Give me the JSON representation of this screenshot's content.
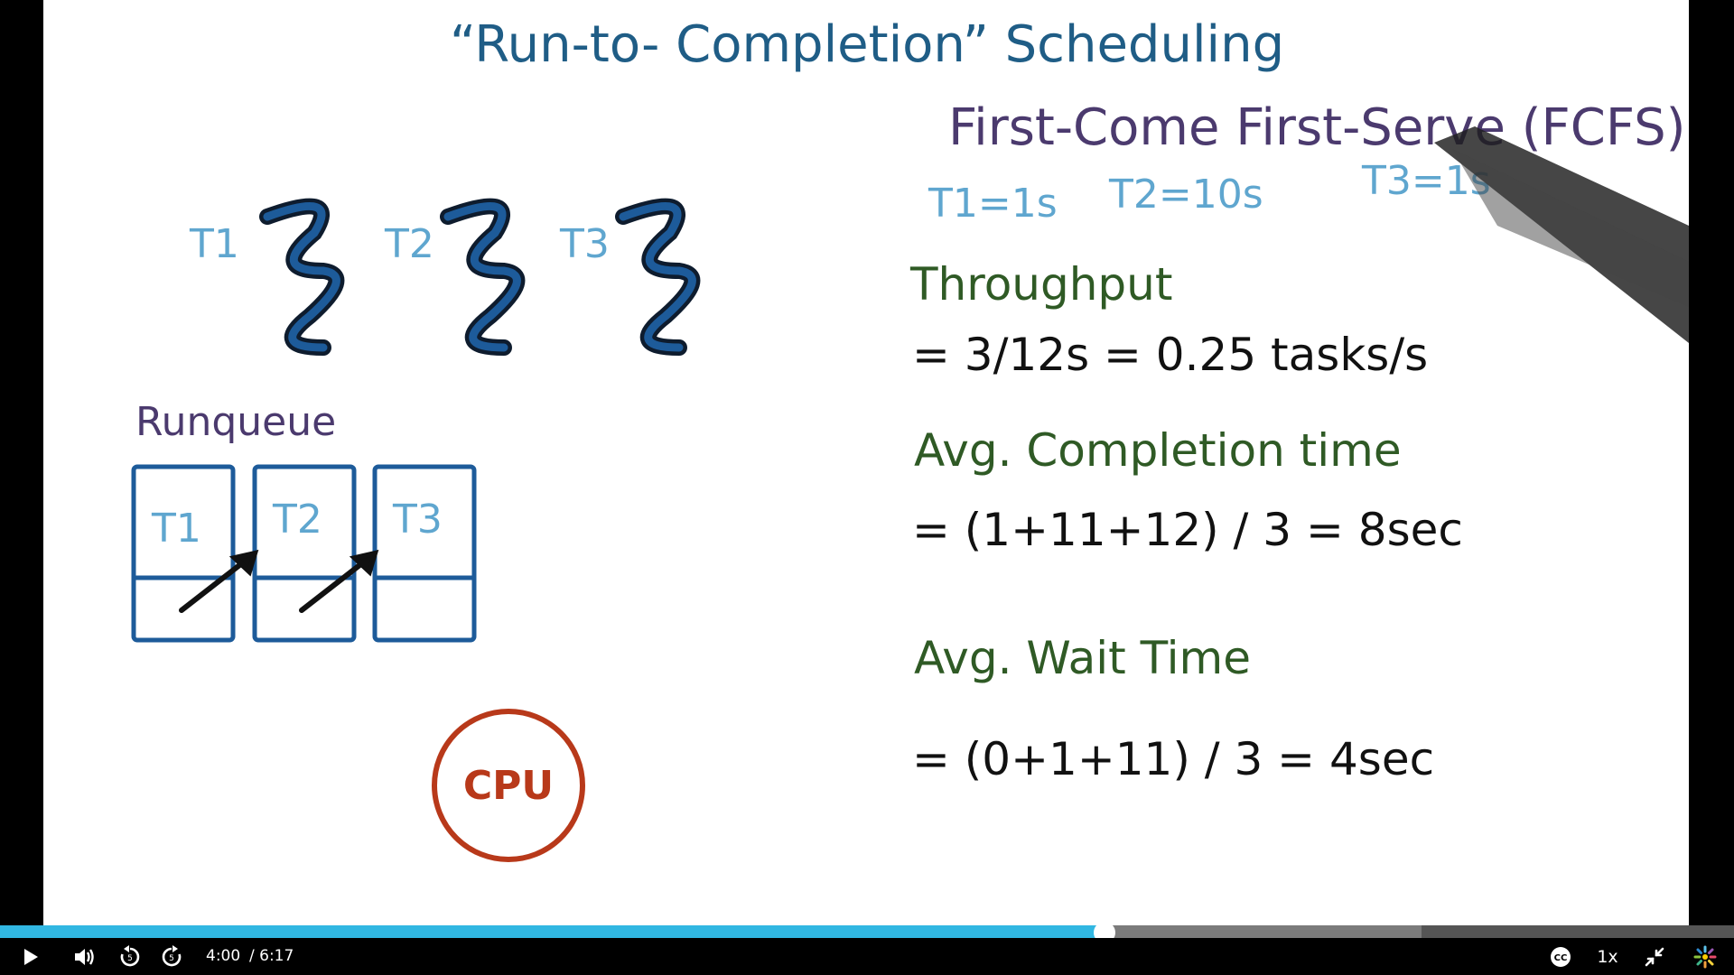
{
  "lecture": {
    "title": "“Run-to- Completion” Scheduling",
    "algorithm": "First-Come First-Serve (FCFS)",
    "task_times": [
      "T1=1s",
      "T2=10s",
      "T3=1s"
    ],
    "threads": [
      "T1",
      "T2",
      "T3"
    ],
    "runqueue_label": "Runqueue",
    "queue_items": [
      "T1",
      "T2",
      "T3"
    ],
    "cpu_label": "CPU",
    "throughput_heading": "Throughput",
    "throughput_formula": "= 3/12s = 0.25 tasks/s",
    "completion_heading": "Avg. Completion time",
    "completion_formula": "= (1+11+12) / 3 = 8sec",
    "wait_heading": "Avg. Wait Time",
    "wait_formula": "= (0+1+11) / 3 = 4sec"
  },
  "player": {
    "current_time": "4:00",
    "total_time": "/ 6:17",
    "progress_fraction": 0.637,
    "buffered_fraction": 0.82,
    "speed": "1x",
    "icons": [
      "play-icon",
      "volume-icon",
      "rewind-icon",
      "forward-icon",
      "closed-captions-icon",
      "exit-fullscreen-icon",
      "brand-logo-icon"
    ],
    "colors": {
      "played": "#31b7e2",
      "buffered": "#7b7b7b",
      "track": "#555555"
    }
  }
}
